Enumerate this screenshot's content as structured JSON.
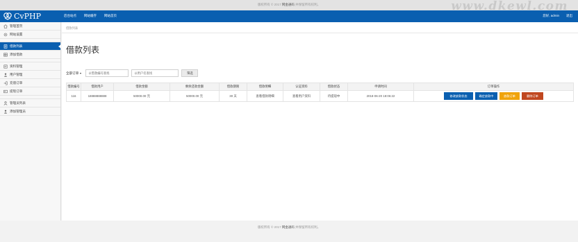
{
  "topbar": {
    "copyright": "版权所有 © 2017",
    "brand": "网金通码",
    "suffix": "并保留所有权利。",
    "watermark": "www.dkewl.com"
  },
  "nav": {
    "logo_text": "CvPHP",
    "links": [
      "后台站点",
      "网站缓存",
      "网站首页"
    ],
    "greeting": "您好, admin",
    "logout": "退出"
  },
  "sidebar": {
    "items": [
      {
        "label": "管理首页",
        "icon": "home-icon"
      },
      {
        "label": "网站设置",
        "icon": "gear-icon"
      },
      {
        "label": "借款列表",
        "icon": "document-icon",
        "active": true
      },
      {
        "label": "添加借款",
        "icon": "table-icon"
      },
      {
        "label": "资料管理",
        "icon": "list-icon"
      },
      {
        "label": "用户管理",
        "icon": "user-icon"
      },
      {
        "label": "充值订单",
        "icon": "login-icon"
      },
      {
        "label": "提现订单",
        "icon": "card-icon"
      },
      {
        "label": "管理员列表",
        "icon": "person-outline-icon"
      },
      {
        "label": "添加管理员",
        "icon": "user-add-icon"
      }
    ]
  },
  "main": {
    "breadcrumb": "借款列表",
    "title": "借款列表",
    "filter": {
      "dropdown_label": "全部订单",
      "order_placeholder": "以借款编号查找",
      "user_placeholder": "以用户名查找",
      "search_button": "筛选"
    },
    "table": {
      "headers": [
        "借款编号",
        "借款用户",
        "借款金额",
        "剩余还款金额",
        "借款期限",
        "借款明细",
        "认证资料",
        "借款状态",
        "申请时间",
        "订单操作"
      ],
      "rows": [
        {
          "id": "116",
          "user": "18888888888",
          "amount": "50000.00 元",
          "remaining": "50000.00 元",
          "term": "30 天",
          "detail": "查看借款明细",
          "auth": "查看用户资料",
          "status": "待提现中",
          "time": "2018-06-20 18:06:22",
          "actions": [
            "修改放款状态",
            "确定放款中",
            "放款订单",
            "删除订单"
          ]
        }
      ]
    }
  },
  "footer": {
    "copyright": "版权所有 © 2017",
    "brand": "网金通码",
    "suffix": "并保留所有权利。"
  },
  "colors": {
    "primary": "#0a5fb0",
    "warning": "#f0a30a",
    "danger": "#c0471f"
  }
}
